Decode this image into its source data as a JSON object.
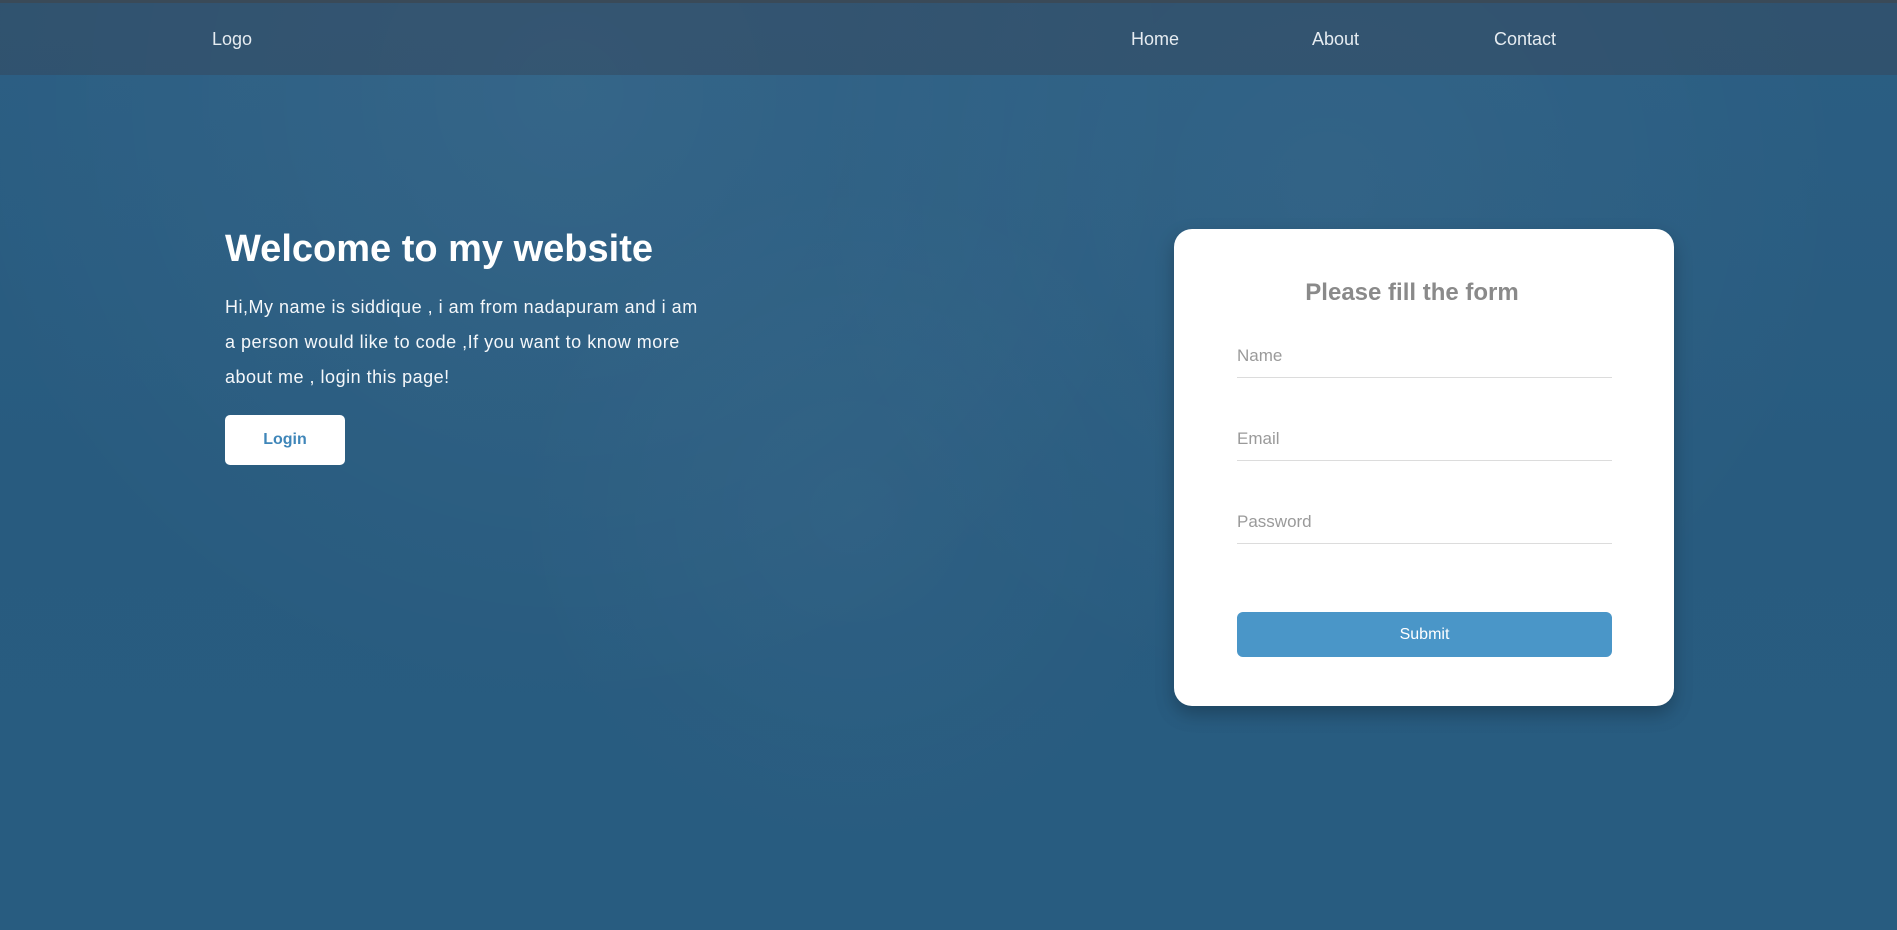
{
  "navbar": {
    "logo": "Logo",
    "links": [
      {
        "label": "Home"
      },
      {
        "label": "About"
      },
      {
        "label": "Contact"
      }
    ]
  },
  "hero": {
    "title": "Welcome to my website",
    "text": "Hi,My name is siddique , i am from nadapuram and i am a person would like to code ,If you want to know more about me , login this page!",
    "login_label": "Login"
  },
  "form": {
    "title": "Please fill the form",
    "name_placeholder": "Name",
    "email_placeholder": "Email",
    "password_placeholder": "Password",
    "submit_label": "Submit"
  },
  "colors": {
    "background": "#2a5d82",
    "accent": "#4a96c8",
    "card": "#ffffff"
  }
}
